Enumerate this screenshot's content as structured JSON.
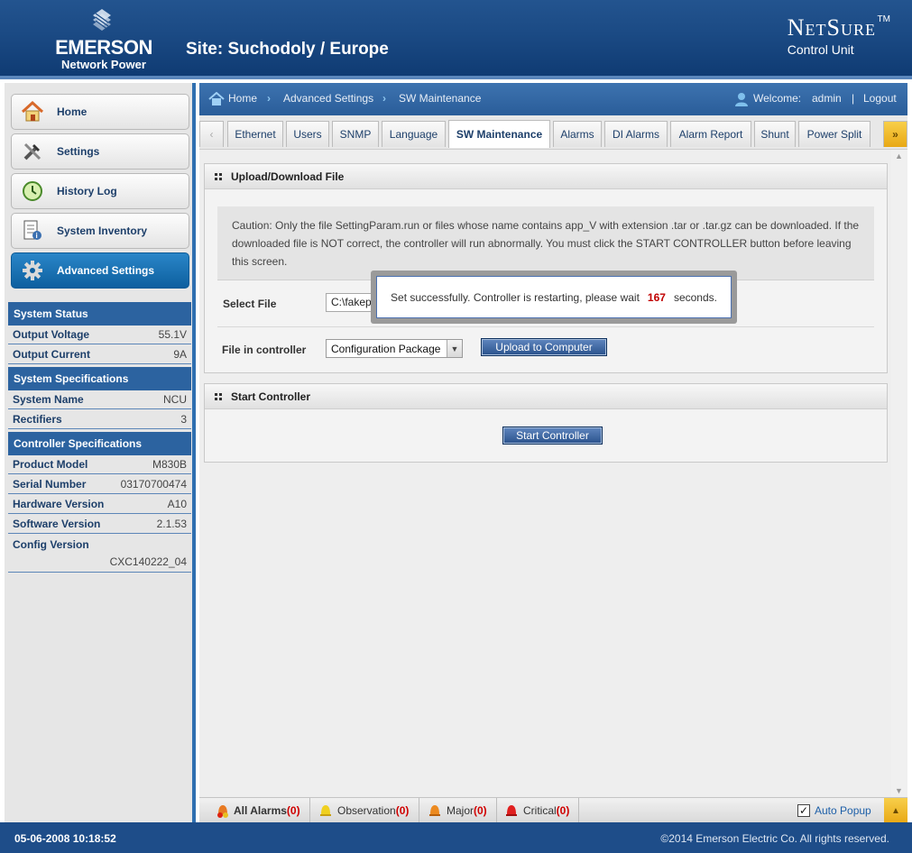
{
  "header": {
    "brand": "EMERSON",
    "brand_sub": "Network Power",
    "site_title": "Site: Suchodoly / Europe",
    "product": "NetSure",
    "product_tm": "TM",
    "product_sub": "Control Unit"
  },
  "nav": {
    "home": "Home",
    "settings": "Settings",
    "history_log": "History Log",
    "system_inventory": "System Inventory",
    "advanced_settings": "Advanced Settings"
  },
  "system_status": {
    "title": "System Status",
    "rows": [
      {
        "label": "Output Voltage",
        "value": "55.1V"
      },
      {
        "label": "Output Current",
        "value": "9A"
      }
    ]
  },
  "system_specifications": {
    "title": "System Specifications",
    "rows": [
      {
        "label": "System Name",
        "value": "NCU"
      },
      {
        "label": "Rectifiers",
        "value": "3"
      }
    ]
  },
  "controller_specifications": {
    "title": "Controller Specifications",
    "rows": [
      {
        "label": "Product Model",
        "value": "M830B"
      },
      {
        "label": "Serial Number",
        "value": "03170700474"
      },
      {
        "label": "Hardware Version",
        "value": "A10"
      },
      {
        "label": "Software Version",
        "value": "2.1.53"
      },
      {
        "label": "Config Version",
        "value": "CXC140222_04"
      }
    ]
  },
  "breadcrumb": {
    "items": [
      "Home",
      "Advanced Settings",
      "SW Maintenance"
    ],
    "welcome": "Welcome:",
    "user": "admin",
    "divider": "|",
    "logout": "Logout"
  },
  "tabs": [
    "Ethernet",
    "Users",
    "SNMP",
    "Language",
    "SW Maintenance",
    "Alarms",
    "DI Alarms",
    "Alarm Report",
    "Shunt",
    "Power Split"
  ],
  "active_tab": "SW Maintenance",
  "upload_panel": {
    "title": "Upload/Download File",
    "caution": "Caution: Only the file SettingParam.run or files whose name contains app_V with extension .tar or .tar.gz can be downloaded. If the downloaded file is NOT correct, the controller will run abnormally. You must click the START CONTROLLER button before leaving this screen.",
    "select_file_label": "Select File",
    "select_file_value": "C:\\fakepa",
    "file_in_controller_label": "File in controller",
    "file_in_controller_value": "Configuration Package",
    "upload_button": "Upload to Computer"
  },
  "start_panel": {
    "title": "Start Controller",
    "button": "Start Controller"
  },
  "dialog": {
    "text_before": "Set successfully. Controller is restarting, please wait",
    "seconds": "167",
    "text_after": "seconds."
  },
  "alarm_bar": {
    "all": {
      "label": "All Alarms",
      "count": "(0)"
    },
    "observation": {
      "label": "Observation",
      "count": "(0)"
    },
    "major": {
      "label": "Major",
      "count": "(0)"
    },
    "critical": {
      "label": "Critical",
      "count": "(0)"
    },
    "auto_popup": "Auto Popup",
    "auto_popup_checked": true
  },
  "footer": {
    "datetime": "05-06-2008 10:18:52",
    "copyright": "©2014 Emerson Electric Co. All rights reserved."
  },
  "colors": {
    "header_blue": "#1b4a84",
    "accent_blue": "#2c63a0",
    "active_nav": "#1a74b6",
    "alarm_red": "#d00000",
    "arrow_tab_yellow": "#f5c02c"
  },
  "icons": [
    "home-icon",
    "settings-tools-icon",
    "history-clock-icon",
    "inventory-document-icon",
    "gear-icon",
    "user-icon",
    "chevron-right-icon",
    "chevron-left-icon",
    "double-chevron-right-icon",
    "alarm-bell-icon",
    "checkbox-icon",
    "chevron-up-icon"
  ]
}
